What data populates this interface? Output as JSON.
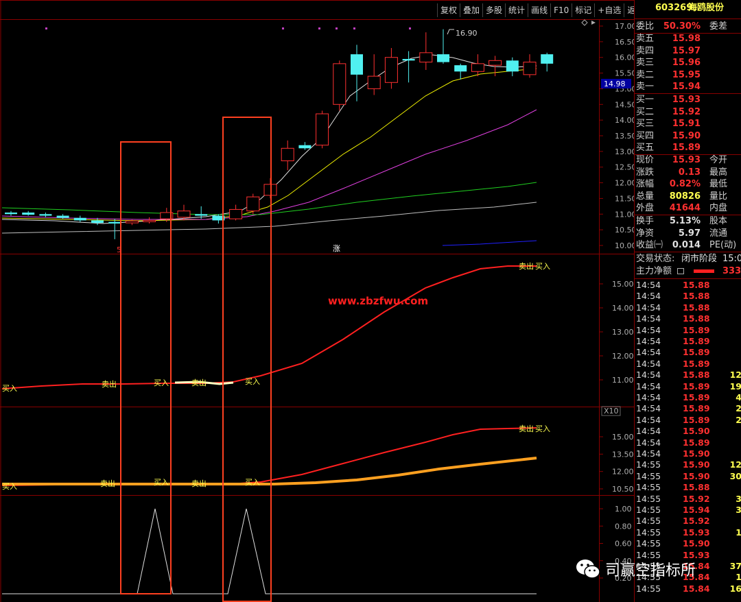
{
  "toolbar": [
    "复权",
    "叠加",
    "多股",
    "统计",
    "画线",
    "F10",
    "标记",
    "+自选",
    "返回"
  ],
  "stock": {
    "code": "603269",
    "name": "海鸥股份"
  },
  "colors": {
    "up": "#ff3030",
    "down": "#50f0f0",
    "ma5": "#e0e0e0",
    "ma10": "#f0f000",
    "ma20": "#e040e0",
    "ma60": "#20d020",
    "ma120": "#c0c0c0",
    "box": "#ff4020",
    "price_label_bg": "#0000a0"
  },
  "main_chart": {
    "y_ticks": [
      "17.00",
      "16.50",
      "16.00",
      "15.50",
      "15.00",
      "14.50",
      "14.00",
      "13.50",
      "13.00",
      "12.50",
      "12.00",
      "11.50",
      "11.00",
      "10.50",
      "10.00"
    ],
    "high_label": "16.90",
    "price_label": "14.98",
    "marker_low": "5",
    "marker_up": "涨"
  },
  "panel2": {
    "y_ticks": [
      "15.00",
      "14.00",
      "13.00",
      "12.00",
      "11.00"
    ],
    "watermark_url": "www.zbzfwu.com",
    "signals": [
      "买入",
      "卖出",
      "买入",
      "卖出",
      "买入",
      "卖出",
      "买入"
    ]
  },
  "panel3": {
    "scale_label": "X10",
    "y_ticks": [
      "15.00",
      "13.50",
      "12.00",
      "10.50"
    ],
    "signals": [
      "买入",
      "卖出",
      "买入",
      "卖出",
      "买入",
      "卖出",
      "买入"
    ]
  },
  "panel4": {
    "y_ticks": [
      "1.00",
      "0.80",
      "0.60",
      "0.40",
      "0.20"
    ]
  },
  "quote": {
    "weibi_label": "委比",
    "weibi": "50.30%",
    "weicha_label": "委差",
    "asks": [
      {
        "label": "卖五",
        "price": "15.98"
      },
      {
        "label": "卖四",
        "price": "15.97"
      },
      {
        "label": "卖三",
        "price": "15.96"
      },
      {
        "label": "卖二",
        "price": "15.95"
      },
      {
        "label": "卖一",
        "price": "15.94"
      }
    ],
    "bids": [
      {
        "label": "买一",
        "price": "15.93"
      },
      {
        "label": "买二",
        "price": "15.92"
      },
      {
        "label": "买三",
        "price": "15.91"
      },
      {
        "label": "买四",
        "price": "15.90"
      },
      {
        "label": "买五",
        "price": "15.89"
      }
    ],
    "stats": [
      {
        "label": "现价",
        "value": "15.93",
        "label2": "今开"
      },
      {
        "label": "涨跌",
        "value": "0.13",
        "label2": "最高"
      },
      {
        "label": "涨幅",
        "value": "0.82%",
        "label2": "最低"
      },
      {
        "label": "总量",
        "value": "80826",
        "label2": "量比"
      },
      {
        "label": "外盘",
        "value": "41644",
        "label2": "内盘"
      }
    ],
    "stats2": [
      {
        "label": "换手",
        "value": "5.13%",
        "label2": "股本"
      },
      {
        "label": "净资",
        "value": "5.97",
        "label2": "流通"
      },
      {
        "label": "收益㈠",
        "value": "0.014",
        "label2": "PE(动)"
      }
    ],
    "status_label": "交易状态:",
    "status_value": "闭市阶段",
    "status_time": "15:0",
    "main_flow_label": "主力净额",
    "main_flow_value": "333."
  },
  "ticks": [
    {
      "time": "14:54",
      "price": "15.88",
      "vol": ""
    },
    {
      "time": "14:54",
      "price": "15.88",
      "vol": ""
    },
    {
      "time": "14:54",
      "price": "15.88",
      "vol": ""
    },
    {
      "time": "14:54",
      "price": "15.88",
      "vol": ""
    },
    {
      "time": "14:54",
      "price": "15.89",
      "vol": ""
    },
    {
      "time": "14:54",
      "price": "15.89",
      "vol": ""
    },
    {
      "time": "14:54",
      "price": "15.89",
      "vol": ""
    },
    {
      "time": "14:54",
      "price": "15.89",
      "vol": ""
    },
    {
      "time": "14:54",
      "price": "15.88",
      "vol": "12"
    },
    {
      "time": "14:54",
      "price": "15.89",
      "vol": "19"
    },
    {
      "time": "14:54",
      "price": "15.89",
      "vol": "4"
    },
    {
      "time": "14:54",
      "price": "15.89",
      "vol": "2"
    },
    {
      "time": "14:54",
      "price": "15.89",
      "vol": "2"
    },
    {
      "time": "14:54",
      "price": "15.90",
      "vol": ""
    },
    {
      "time": "14:54",
      "price": "15.89",
      "vol": ""
    },
    {
      "time": "14:54",
      "price": "15.90",
      "vol": ""
    },
    {
      "time": "14:55",
      "price": "15.90",
      "vol": "12"
    },
    {
      "time": "14:55",
      "price": "15.90",
      "vol": "30"
    },
    {
      "time": "14:55",
      "price": "15.88",
      "vol": ""
    },
    {
      "time": "14:55",
      "price": "15.92",
      "vol": "3"
    },
    {
      "time": "14:55",
      "price": "15.94",
      "vol": "3"
    },
    {
      "time": "14:55",
      "price": "15.92",
      "vol": ""
    },
    {
      "time": "14:55",
      "price": "15.93",
      "vol": "1"
    },
    {
      "time": "14:55",
      "price": "15.90",
      "vol": ""
    },
    {
      "time": "14:55",
      "price": "15.93",
      "vol": ""
    },
    {
      "time": "14:55",
      "price": "15.84",
      "vol": "37"
    },
    {
      "time": "14:55",
      "price": "15.84",
      "vol": "1"
    },
    {
      "time": "14:55",
      "price": "15.84",
      "vol": "16"
    }
  ],
  "watermark": {
    "text": "司赢空指标所",
    "icon": "wechat-icon"
  },
  "chart_data": {
    "type": "candlestick",
    "candles": [
      {
        "o": 11.0,
        "c": 11.05,
        "h": 11.1,
        "l": 10.95,
        "up": false
      },
      {
        "o": 11.05,
        "c": 10.98,
        "h": 11.1,
        "l": 10.95,
        "up": false
      },
      {
        "o": 11.0,
        "c": 10.95,
        "h": 11.05,
        "l": 10.9,
        "up": false
      },
      {
        "o": 10.95,
        "c": 10.88,
        "h": 11.0,
        "l": 10.85,
        "up": false
      },
      {
        "o": 10.88,
        "c": 10.8,
        "h": 10.95,
        "l": 10.75,
        "up": false
      },
      {
        "o": 10.8,
        "c": 10.72,
        "h": 10.88,
        "l": 10.65,
        "up": false
      },
      {
        "o": 10.75,
        "c": 10.7,
        "h": 10.85,
        "l": 10.2,
        "up": false
      },
      {
        "o": 10.72,
        "c": 10.78,
        "h": 10.82,
        "l": 10.65,
        "up": true
      },
      {
        "o": 10.78,
        "c": 10.8,
        "h": 10.9,
        "l": 10.7,
        "up": true
      },
      {
        "o": 10.85,
        "c": 11.05,
        "h": 11.2,
        "l": 10.75,
        "up": true
      },
      {
        "o": 10.9,
        "c": 11.1,
        "h": 11.3,
        "l": 10.8,
        "up": true
      },
      {
        "o": 11.0,
        "c": 10.95,
        "h": 11.25,
        "l": 10.85,
        "up": false
      },
      {
        "o": 10.95,
        "c": 10.8,
        "h": 11.0,
        "l": 10.7,
        "up": false
      },
      {
        "o": 10.85,
        "c": 11.15,
        "h": 11.3,
        "l": 10.8,
        "up": true
      },
      {
        "o": 11.1,
        "c": 11.55,
        "h": 11.65,
        "l": 11.0,
        "up": true
      },
      {
        "o": 11.6,
        "c": 11.95,
        "h": 12.15,
        "l": 11.5,
        "up": true
      },
      {
        "o": 12.7,
        "c": 13.1,
        "h": 13.35,
        "l": 12.4,
        "up": true
      },
      {
        "o": 13.2,
        "c": 13.1,
        "h": 13.3,
        "l": 13.05,
        "up": false
      },
      {
        "o": 13.2,
        "c": 14.2,
        "h": 14.3,
        "l": 13.1,
        "up": true
      },
      {
        "o": 14.5,
        "c": 15.8,
        "h": 15.9,
        "l": 14.3,
        "up": true
      },
      {
        "o": 16.1,
        "c": 15.45,
        "h": 16.4,
        "l": 14.6,
        "up": false
      },
      {
        "o": 15.0,
        "c": 15.4,
        "h": 16.1,
        "l": 14.8,
        "up": true
      },
      {
        "o": 15.2,
        "c": 16.0,
        "h": 16.3,
        "l": 15.0,
        "up": true
      },
      {
        "o": 15.95,
        "c": 15.9,
        "h": 16.2,
        "l": 15.2,
        "up": false
      },
      {
        "o": 15.85,
        "c": 16.15,
        "h": 16.8,
        "l": 15.6,
        "up": true
      },
      {
        "o": 16.1,
        "c": 15.85,
        "h": 16.9,
        "l": 15.8,
        "up": false
      },
      {
        "o": 15.75,
        "c": 15.55,
        "h": 15.8,
        "l": 15.3,
        "up": false
      },
      {
        "o": 15.55,
        "c": 15.8,
        "h": 16.1,
        "l": 15.4,
        "up": true
      },
      {
        "o": 15.75,
        "c": 15.9,
        "h": 16.05,
        "l": 15.4,
        "up": true
      },
      {
        "o": 15.9,
        "c": 15.55,
        "h": 16.0,
        "l": 15.4,
        "up": false
      },
      {
        "o": 15.45,
        "c": 15.85,
        "h": 16.1,
        "l": 15.35,
        "up": true
      },
      {
        "o": 15.8,
        "c": 16.1,
        "h": 16.15,
        "l": 15.55,
        "up": false
      }
    ]
  }
}
